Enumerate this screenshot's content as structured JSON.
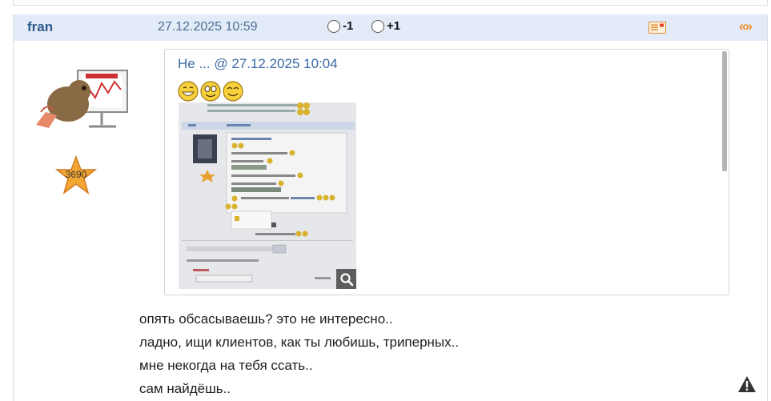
{
  "post": {
    "author": "fran",
    "date": "27.12.2025 10:59",
    "vote_minus": "-1",
    "vote_plus": "+1",
    "quote_link": "«»",
    "rating": "3690",
    "quote": {
      "title": "Не ... @ 27.12.2025 10:04"
    },
    "message_lines": [
      "опять обсасываешь? это не интересно..",
      "ладно, ищи клиентов, как ты любишь, триперных..",
      "мне некогда на тебя ссать..",
      "сам найдёшь.."
    ]
  },
  "icons": {
    "card": "business-card-icon",
    "quote": "quote-icon",
    "zoom": "magnifier-icon",
    "warning": "warning-icon",
    "rating": "star-icon"
  },
  "colors": {
    "header_bg": "#e3ebf8",
    "author": "#2e5a8e",
    "date": "#4a6c94",
    "quote_link": "#f08b2c",
    "quote_title": "#3a6aa6"
  }
}
